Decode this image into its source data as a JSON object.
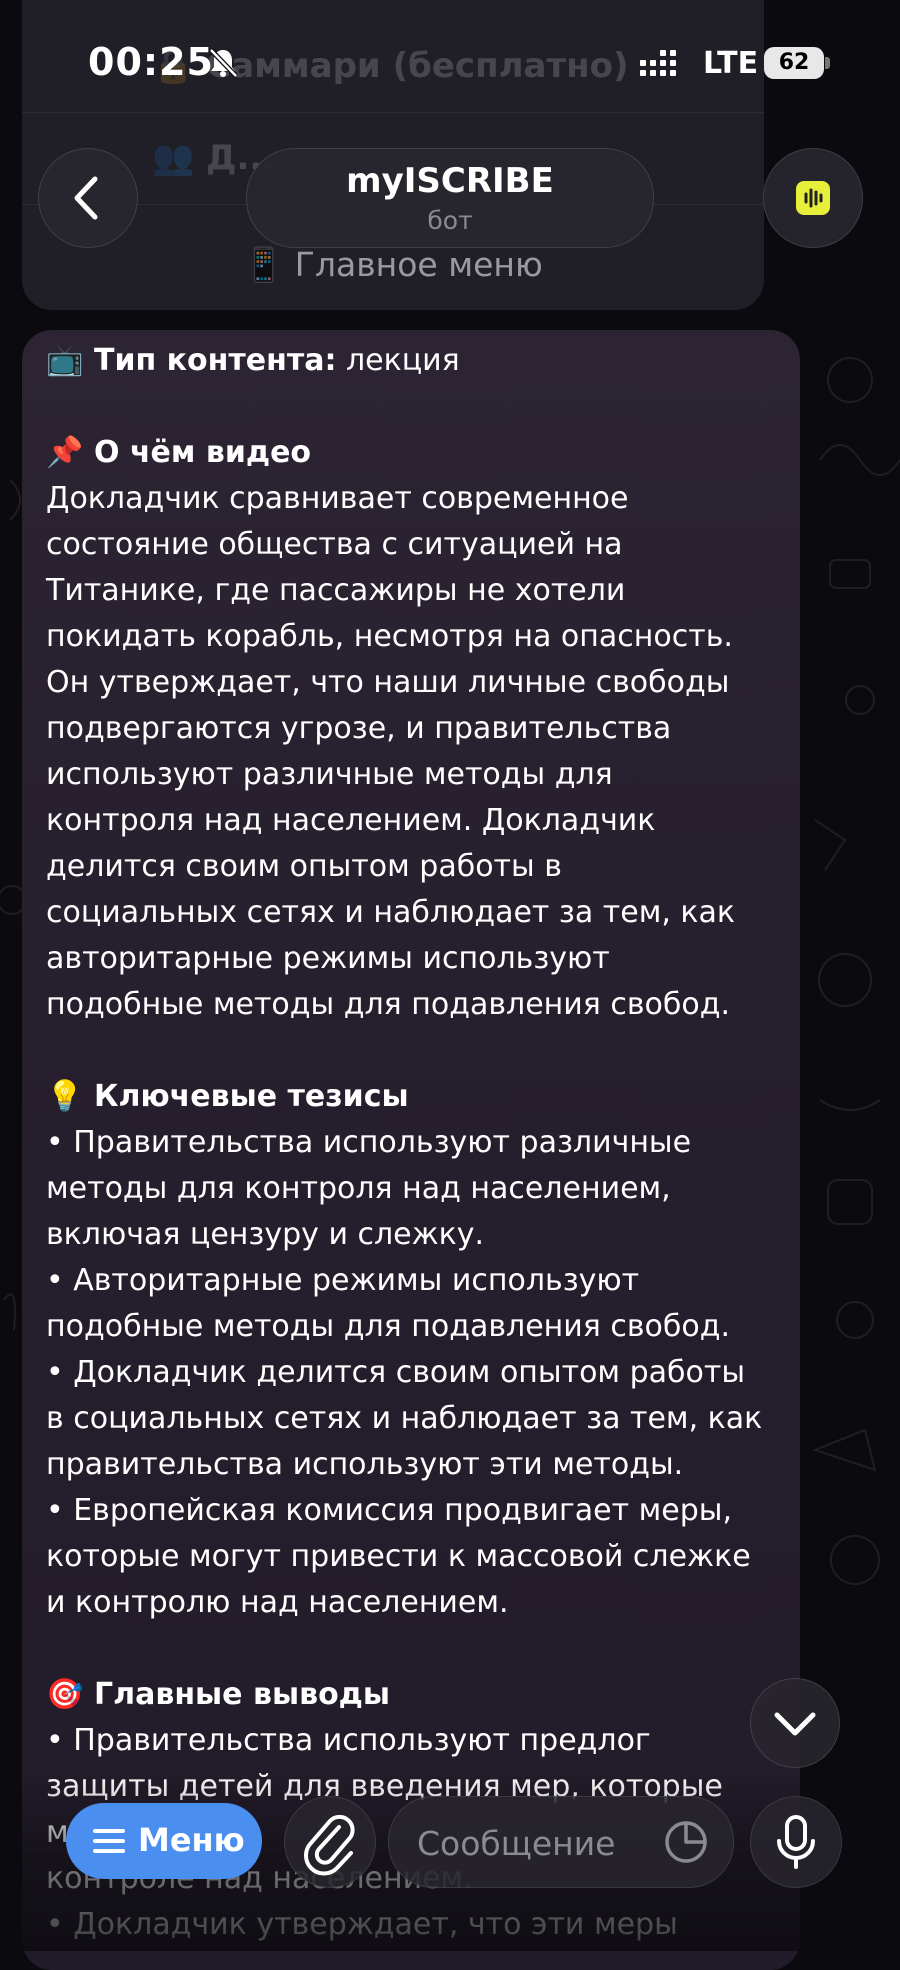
{
  "status_bar": {
    "time": "00:25",
    "network": "LTE",
    "battery": "62"
  },
  "keyboard_behind": {
    "row1": "🔒 Саммари (бесплатно)",
    "row2": "👥 Д...",
    "main_menu_button": "📱 Главное меню"
  },
  "header": {
    "title": "myISCRIBE",
    "subtitle": "бот"
  },
  "message": {
    "content_type_label": "Тип контента:",
    "content_type_value": " лекция",
    "section1_title": "О чём видео",
    "section1_lines": [
      "Докладчик сравнивает современное",
      "состояние общества с ситуацией на",
      "Титанике, где пассажиры не хотели",
      "покидать корабль, несмотря на опасность.",
      "Он утверждает, что наши личные свободы",
      "подвергаются угрозе, и правительства",
      "используют различные методы для",
      "контроля над населением. Докладчик",
      "делится своим опытом работы в",
      "социальных сетях и наблюдает за тем, как",
      "авторитарные режимы используют",
      "подобные методы для подавления свобод."
    ],
    "section2_title": "Ключевые тезисы",
    "section2_lines": [
      "• Правительства используют различные",
      "методы для контроля над населением,",
      "включая цензуру и слежку.",
      "• Авторитарные режимы используют",
      "подобные методы для подавления свобод.",
      "• Докладчик делится своим опытом работы",
      "в социальных сетях и наблюдает за тем, как",
      "правительства используют эти методы.",
      "• Европейская комиссия продвигает меры,",
      "которые могут привести к массовой слежке",
      "и контролю над населением."
    ],
    "section3_title": "Главные выводы",
    "section3_lines": [
      "• Правительства используют предлог",
      "защиты детей для введения мер, которые",
      "м                 т                а",
      "контроле над населением.",
      "• Докладчик утверждает, что эти меры"
    ]
  },
  "composer": {
    "menu_label": "Меню",
    "placeholder": "Сообщение"
  },
  "icons": {
    "content_type": "📺",
    "pin": "📌",
    "bulb": "💡",
    "target": "🎯"
  },
  "colors": {
    "accent_blue": "#4a8ef0",
    "bot_avatar": "#e6ef3a",
    "bubble": "#2a2331"
  }
}
